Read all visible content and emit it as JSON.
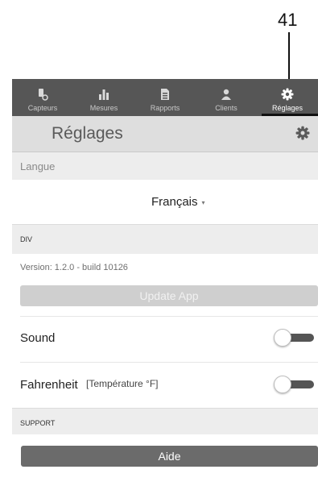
{
  "callout": {
    "number": "41"
  },
  "tabs": [
    {
      "label": "Capteurs",
      "icon": "sensor-icon",
      "active": false
    },
    {
      "label": "Mesures",
      "icon": "bar-chart-icon",
      "active": false
    },
    {
      "label": "Rapports",
      "icon": "report-icon",
      "active": false
    },
    {
      "label": "Clients",
      "icon": "user-icon",
      "active": false
    },
    {
      "label": "Réglages",
      "icon": "gear-icon",
      "active": true
    }
  ],
  "header": {
    "title": "Réglages",
    "icon": "gear-icon"
  },
  "language": {
    "section_label": "Langue",
    "selected": "Français",
    "caret": "▾"
  },
  "div_section": {
    "label": "DIV",
    "version": "Version: 1.2.0 - build 10126",
    "update_button": "Update App"
  },
  "sound": {
    "label": "Sound",
    "enabled": false
  },
  "fahrenheit": {
    "label": "Fahrenheit",
    "sublabel": "[Température °F]",
    "enabled": false
  },
  "support": {
    "label": "SUPPORT",
    "help_button": "Aide"
  },
  "colors": {
    "tabbar": "#565656",
    "header": "#dedede",
    "section": "#ededed",
    "toggle_track": "#555555",
    "help_button": "#6b6b6b",
    "update_button": "#cfcfcf"
  }
}
